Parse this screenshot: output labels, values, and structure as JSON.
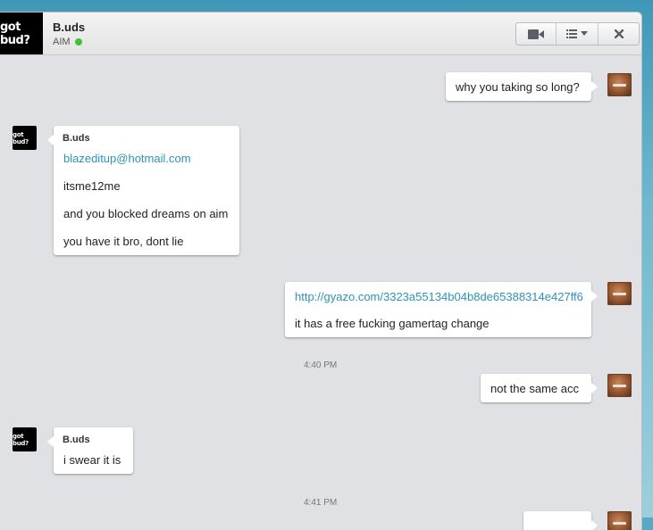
{
  "header": {
    "avatar_text": "got bud?",
    "contact_name": "B.uds",
    "status": "AIM"
  },
  "messages": {
    "m1": {
      "text": "why you taking so long?"
    },
    "m2": {
      "sender": "B.uds",
      "lines": [
        "blazeditup@hotmail.com",
        "itsme12me",
        "and you blocked dreams on aim",
        "you have it bro, dont lie"
      ]
    },
    "m3": {
      "lines": [
        "http://gyazo.com/3323a55134b04b8de65388314e427ff6",
        "it has a free fucking gamertag change"
      ]
    },
    "ts1": "4:40 PM",
    "m4": {
      "text": "not the same acc"
    },
    "m5": {
      "sender": "B.uds",
      "text": "i swear it is"
    },
    "ts2": "4:41 PM",
    "bud_avatar_text": "got bud?"
  },
  "colors": {
    "link": "#2f93b5",
    "online": "#3fc23a"
  }
}
